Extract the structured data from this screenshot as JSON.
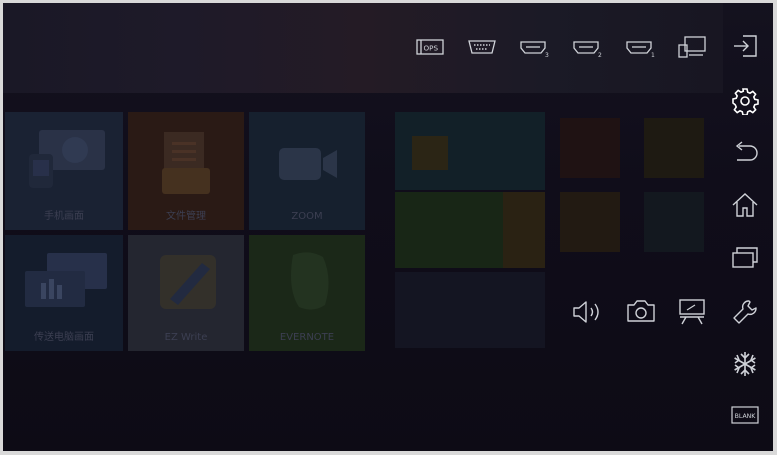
{
  "apps": [
    {
      "label": "手机画面",
      "color": "#1a2233"
    },
    {
      "label": "文件管理",
      "color": "#2a1a15"
    },
    {
      "label": "ZOOM",
      "color": "#16202e"
    },
    {
      "label": "传送电脑画面",
      "color": "#141c2c"
    },
    {
      "label": "EZ Write",
      "color": "#242630"
    },
    {
      "label": "EVERNOTE",
      "color": "#1b2818"
    }
  ],
  "inputs": [
    {
      "icon": "ops-input-icon",
      "text": "OPS"
    },
    {
      "icon": "vga-input-icon",
      "text": ""
    },
    {
      "icon": "hdmi-input-icon",
      "text": "3"
    },
    {
      "icon": "hdmi-input-icon",
      "text": "2"
    },
    {
      "icon": "hdmi-input-icon",
      "text": "1"
    },
    {
      "icon": "pc-screen-icon",
      "text": ""
    }
  ],
  "sidebar": {
    "blank_label": "BLANK"
  },
  "colors": {
    "icon": "#cfd2d8",
    "frame": "#d9d9d9"
  }
}
